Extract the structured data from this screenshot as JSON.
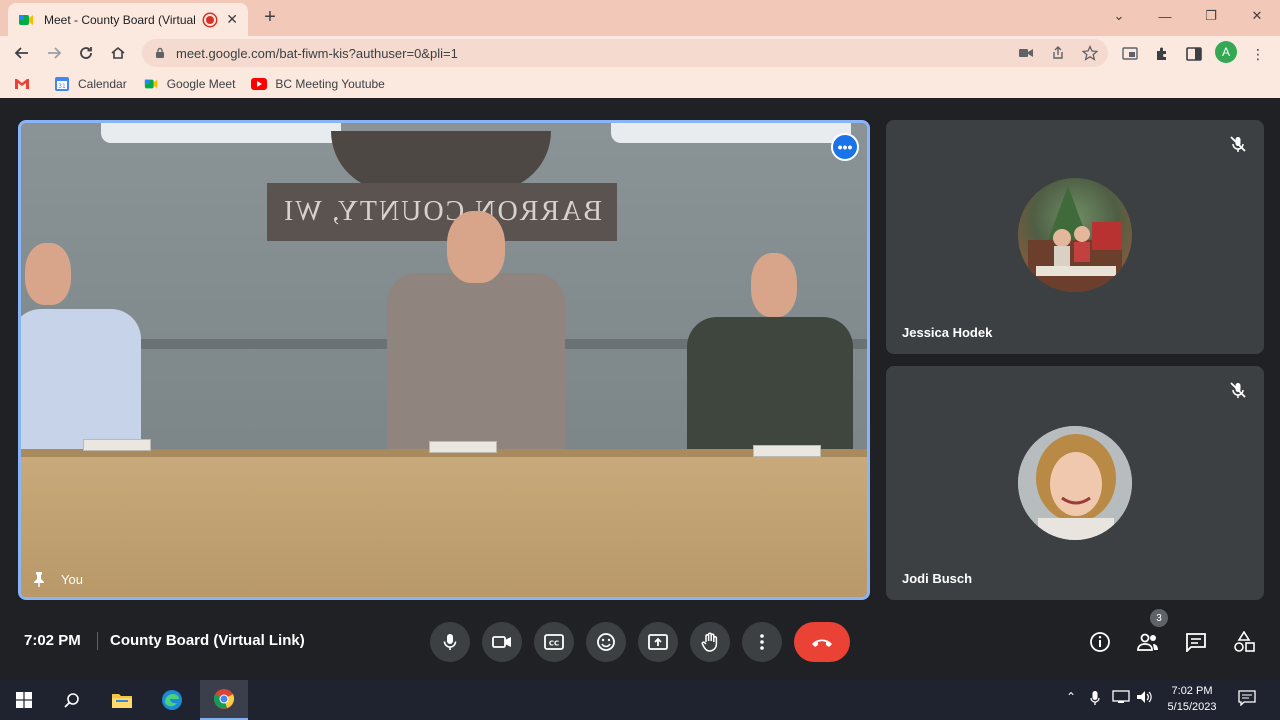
{
  "browser": {
    "tab_title": "Meet - County Board (Virtual",
    "tab_close": "✕",
    "new_tab": "+",
    "url": "meet.google.com/bat-fiwm-kis?authuser=0&pli=1",
    "profile_initial": "A",
    "bookmarks": [
      {
        "label": "",
        "icon": "gmail-icon",
        "color": "#ea4335"
      },
      {
        "label": "Calendar",
        "icon": "calendar-icon",
        "color": "#4285f4"
      },
      {
        "label": "Google Meet",
        "icon": "meet-icon",
        "color": "#00ac47"
      },
      {
        "label": "BC Meeting Youtube",
        "icon": "youtube-icon",
        "color": "#ff0000"
      }
    ]
  },
  "meeting": {
    "main_tile_label": "You",
    "seal_text": "BARRON COUNTY, WI",
    "participants": [
      {
        "name": "Jessica Hodek",
        "muted": true
      },
      {
        "name": "Jodi Busch",
        "muted": true
      }
    ],
    "time": "7:02 PM",
    "title": "County Board (Virtual Link)",
    "people_count": "3"
  },
  "taskbar": {
    "time": "7:02 PM",
    "date": "5/15/2023"
  },
  "colors": {
    "accent": "#8ab4f8",
    "end_call": "#ea4335",
    "tile_bg": "#3c4043",
    "stage_bg": "#202124"
  }
}
